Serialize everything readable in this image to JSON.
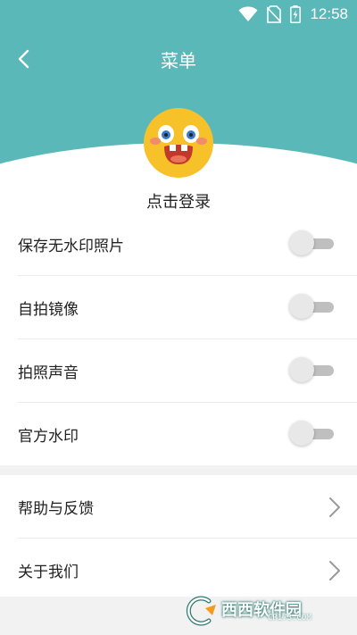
{
  "status_bar": {
    "time": "12:58",
    "icons": [
      "wifi-icon",
      "no-sim-icon",
      "battery-charging-icon"
    ]
  },
  "header": {
    "title": "菜单",
    "back_icon": "chevron-left-icon",
    "background_color": "#5ab8b8"
  },
  "profile": {
    "avatar_icon": "emoji-face-avatar",
    "login_label": "点击登录"
  },
  "settings": {
    "toggles": [
      {
        "label": "保存无水印照片",
        "on": false
      },
      {
        "label": "自拍镜像",
        "on": false
      },
      {
        "label": "拍照声音",
        "on": false
      },
      {
        "label": "官方水印",
        "on": false
      }
    ],
    "links": [
      {
        "label": "帮助与反馈",
        "icon": "chevron-right-icon"
      },
      {
        "label": "关于我们",
        "icon": "chevron-right-icon"
      }
    ]
  },
  "watermark": {
    "brand": "西西软件园",
    "url": "CR173.COM"
  }
}
